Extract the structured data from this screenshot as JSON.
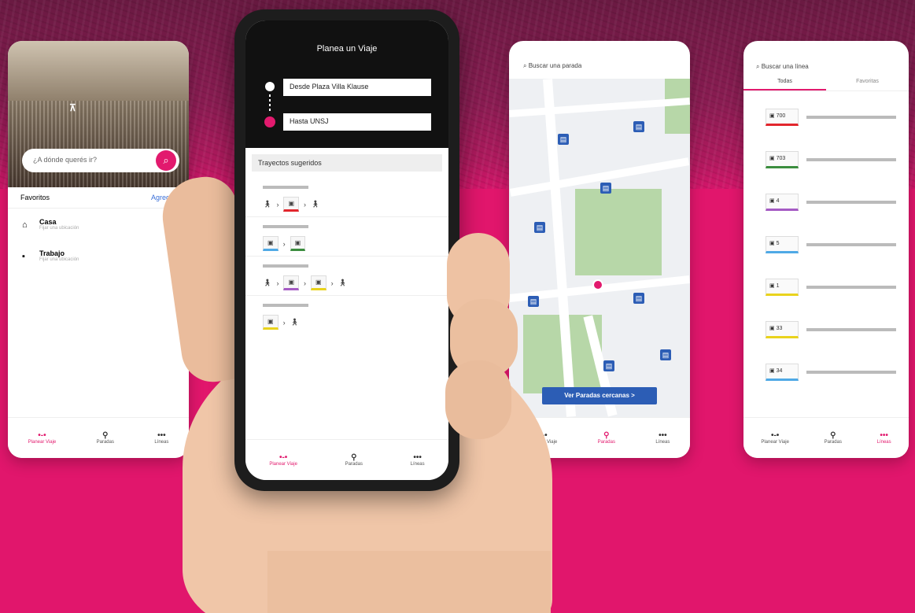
{
  "colors": {
    "brand": "#e21a6e",
    "map_button": "#2c5db5"
  },
  "screen_home": {
    "search_placeholder": "¿A dónde querés ir?",
    "favorites_title": "Favoritos",
    "favorites_add": "Agregar",
    "favorites": [
      {
        "name": "Casa",
        "subtitle": "Fijar una ubicación",
        "icon": "home-icon"
      },
      {
        "name": "Trabajo",
        "subtitle": "Fijar una ubicación",
        "icon": "briefcase-icon"
      }
    ],
    "tabs": [
      "Planear Viaje",
      "Paradas",
      "Líneas"
    ]
  },
  "screen_plan": {
    "title": "Planea un Viaje",
    "from": "Desde Plaza Villa Klause",
    "to": "Hasta UNSJ",
    "suggested_title": "Trayectos sugeridos",
    "tabs": [
      "Planear Viaje",
      "Paradas",
      "Líneas"
    ]
  },
  "screen_map": {
    "search_placeholder": "Buscar una parada",
    "button": "Ver Paradas cercanas >",
    "tabs": [
      "Planear Viaje",
      "Paradas",
      "Líneas"
    ]
  },
  "screen_lines": {
    "search_placeholder": "Buscar una línea",
    "tabs": [
      "Todas",
      "Favoritas"
    ],
    "lines": [
      {
        "code": "700",
        "color": "#e2262d"
      },
      {
        "code": "703",
        "color": "#3b8d3e"
      },
      {
        "code": "4",
        "color": "#a55bc4"
      },
      {
        "code": "5",
        "color": "#4fa9e6"
      },
      {
        "code": "1",
        "color": "#e9d31c"
      },
      {
        "code": "33",
        "color": "#e9d31c"
      },
      {
        "code": "34",
        "color": "#4fa9e6"
      }
    ],
    "nav_tabs": [
      "Planear Viaje",
      "Paradas",
      "Líneas"
    ]
  }
}
